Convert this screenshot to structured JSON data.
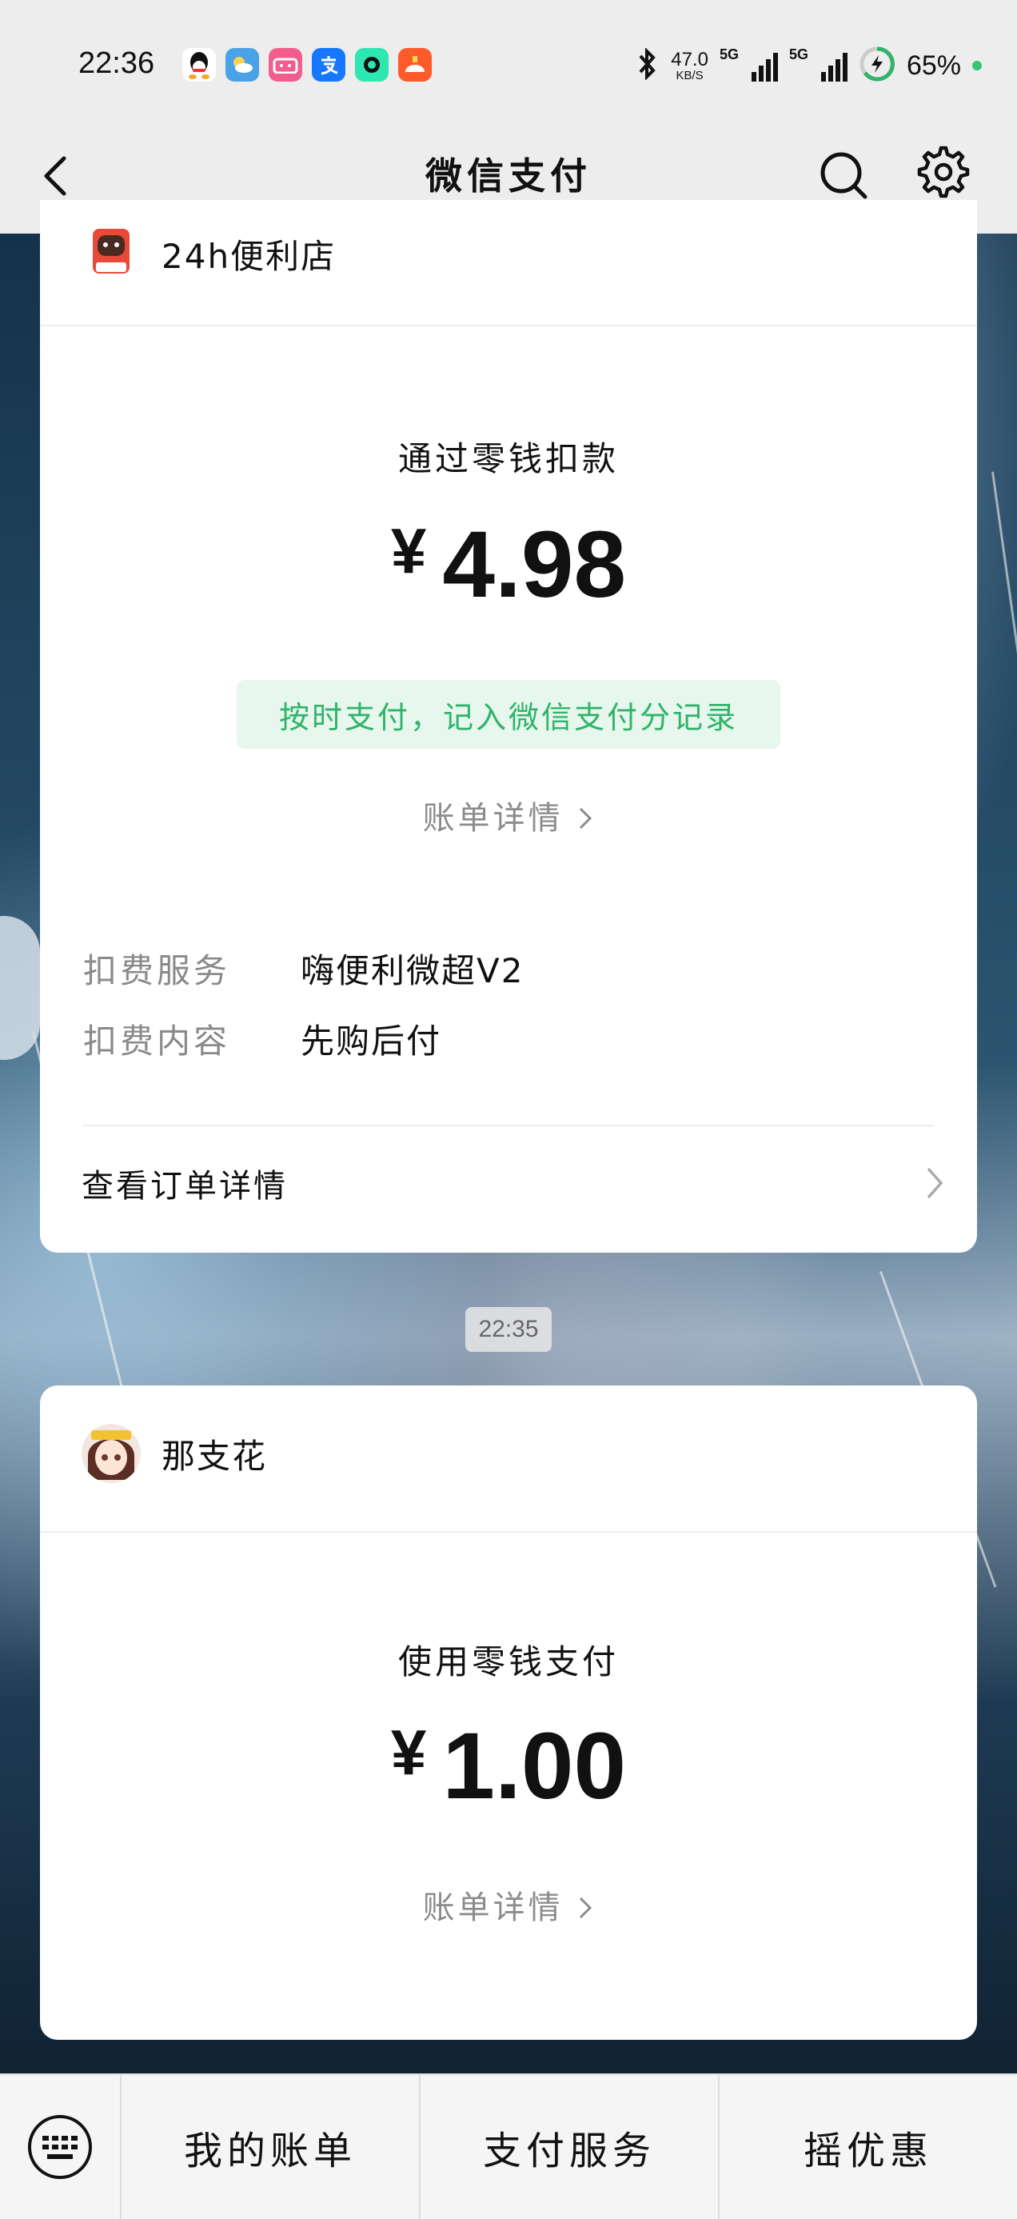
{
  "status_bar": {
    "time": "22:36",
    "net_speed_value": "47.0",
    "net_speed_unit": "KB/S",
    "signal1_label": "5G",
    "signal2_label": "5G",
    "battery": "65%",
    "app_icons": [
      "qq-icon",
      "weather-icon",
      "bilibili-icon",
      "alipay-icon",
      "app-icon",
      "app-icon"
    ]
  },
  "header": {
    "title": "微信支付"
  },
  "cards": [
    {
      "merchant_name": "24h便利店",
      "pay_method": "通过零钱扣款",
      "currency": "¥",
      "amount": "4.98",
      "badge": "按时支付，记入微信支付分记录",
      "bill_link": "账单详情",
      "details": [
        {
          "key": "扣费服务",
          "value": "嗨便利微超V2"
        },
        {
          "key": "扣费内容",
          "value": "先购后付"
        }
      ],
      "order_link": "查看订单详情"
    },
    {
      "merchant_name": "那支花",
      "pay_method": "使用零钱支付",
      "currency": "¥",
      "amount": "1.00",
      "bill_link": "账单详情"
    }
  ],
  "timestamp": "22:35",
  "bottom_tabs": [
    "我的账单",
    "支付服务",
    "摇优惠"
  ],
  "colors": {
    "accent_green": "#2fb46a",
    "badge_bg": "#e7f7ed",
    "bar_bg": "#ededed"
  }
}
